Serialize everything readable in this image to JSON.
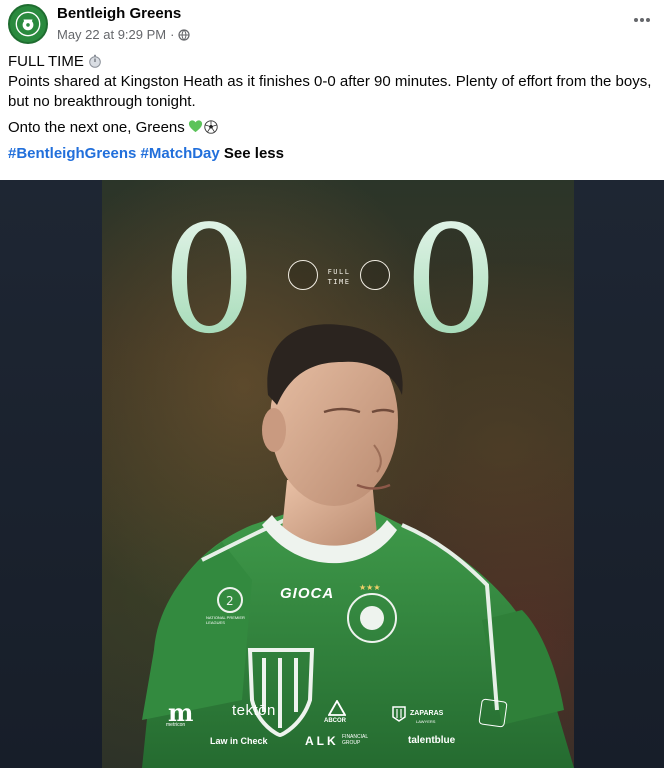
{
  "post": {
    "page_name": "Bentleigh Greens",
    "timestamp": "May 22 at 9:29 PM",
    "separator": "·",
    "line1": "FULL TIME",
    "line2": "Points shared at Kingston Heath as it finishes 0-0 after 90 minutes. Plenty of effort from the boys, but no breakthrough tonight.",
    "line3": "Onto the next one, Greens",
    "hashtag1": "#BentleighGreens",
    "hashtag2": "#MatchDay",
    "see_less": "See less"
  },
  "graphic": {
    "home_score": "0",
    "away_score": "0",
    "status_line1": "FULL",
    "status_line2": "TIME",
    "shirt_sponsor": "GIOCA",
    "league_badge": "NATIONAL PREMIER LEAGUES",
    "sponsors": [
      "m",
      "metricon",
      "tektōn",
      "ABCOR",
      "ZAPARAS",
      "LAWYERS",
      "Law in Check",
      "ALK",
      "FINANCIAL GROUP",
      "talentblue"
    ]
  },
  "icons": {
    "stopwatch": "stopwatch-icon",
    "heart": "green-heart-icon",
    "ball": "soccer-ball-icon",
    "globe": "globe-icon",
    "more": "more-options-icon"
  },
  "colors": {
    "hashtag": "#216fdb",
    "club_green": "#2a8a3e",
    "score_mint": "#bfe6cc"
  }
}
